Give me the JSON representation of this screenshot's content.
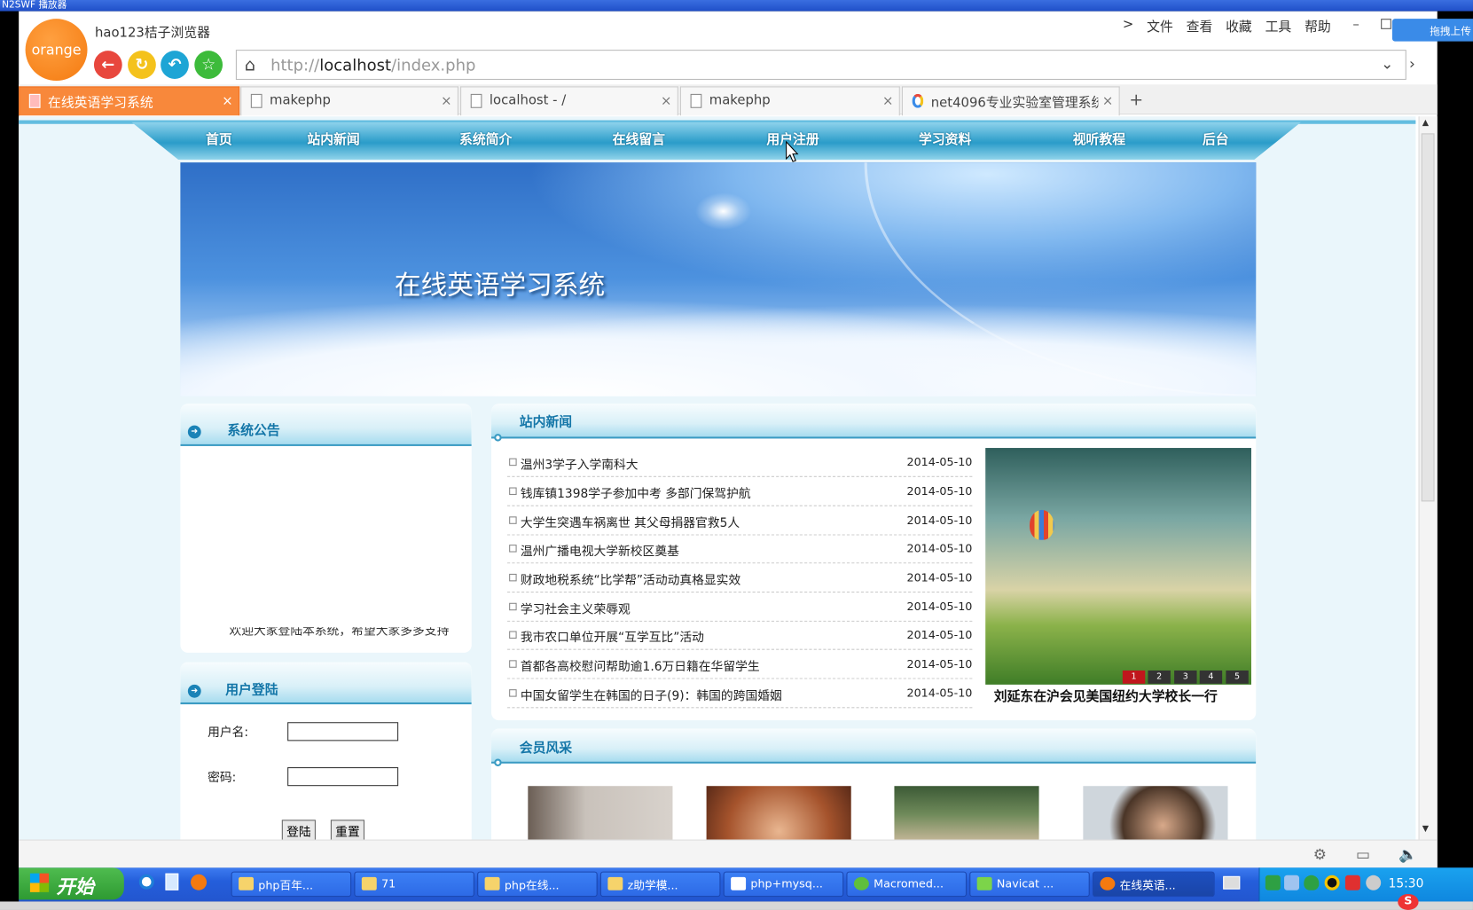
{
  "window": {
    "app_title": "N2SWF 播放器"
  },
  "browser": {
    "logo_text": "orange",
    "title": "hao123桔子浏览器",
    "menu": [
      "文件",
      "查看",
      "收藏",
      "工具",
      "帮助"
    ],
    "menu_arrow": ">",
    "side_button": "拖拽上传",
    "nav_buttons": {
      "back": "←",
      "refresh": "↻",
      "undo": "↶",
      "favorite": "☆"
    },
    "url": {
      "prefix": "http://",
      "host": "localhost",
      "path": "/index.php"
    },
    "tabs": [
      {
        "label": "在线英语学习系统",
        "active": true
      },
      {
        "label": "makephp",
        "active": false
      },
      {
        "label": "localhost - /",
        "active": false
      },
      {
        "label": "makephp",
        "active": false
      },
      {
        "label": "net4096专业实验室管理系统",
        "active": false
      }
    ],
    "new_tab": "+",
    "close_glyph": "×"
  },
  "site": {
    "nav": [
      "首页",
      "站内新闻",
      "系统简介",
      "在线留言",
      "用户注册",
      "学习资料",
      "视听教程",
      "后台"
    ],
    "banner_title": "在线英语学习系统",
    "notice": {
      "title": "系统公告",
      "scroll_text": "欢迎大家登陆本系统，希望大家多多支持"
    },
    "login": {
      "title": "用户登陆",
      "username_label": "用户名:",
      "password_label": "密码:",
      "login_button": "登陆",
      "reset_button": "重置"
    },
    "news": {
      "title": "站内新闻",
      "items": [
        {
          "title": "温州3学子入学南科大",
          "date": "2014-05-10"
        },
        {
          "title": "钱库镇1398学子参加中考 多部门保驾护航",
          "date": "2014-05-10"
        },
        {
          "title": "大学生突遇车祸离世 其父母捐器官救5人",
          "date": "2014-05-10"
        },
        {
          "title": "温州广播电视大学新校区奠基",
          "date": "2014-05-10"
        },
        {
          "title": "财政地税系统“比学帮”活动动真格显实效",
          "date": "2014-05-10"
        },
        {
          "title": "学习社会主义荣辱观",
          "date": "2014-05-10"
        },
        {
          "title": "我市农口单位开展“互学互比”活动",
          "date": "2014-05-10"
        },
        {
          "title": "首都各高校慰问帮助逾1.6万日籍在华留学生",
          "date": "2014-05-10"
        },
        {
          "title": "中国女留学生在韩国的日子(9)：韩国的跨国婚姻",
          "date": "2014-05-10"
        }
      ],
      "slider_pages": [
        "1",
        "2",
        "3",
        "4",
        "5"
      ],
      "slider_caption": "刘延东在沪会见美国纽约大学校长一行"
    },
    "members": {
      "title": "会员风采"
    }
  },
  "taskbar": {
    "start": "开始",
    "items": [
      "php百年...",
      "71",
      "php在线...",
      "z助学模...",
      "php+mysq...",
      "Macromed...",
      "Navicat ...",
      "在线英语..."
    ],
    "clock": "15:30"
  }
}
